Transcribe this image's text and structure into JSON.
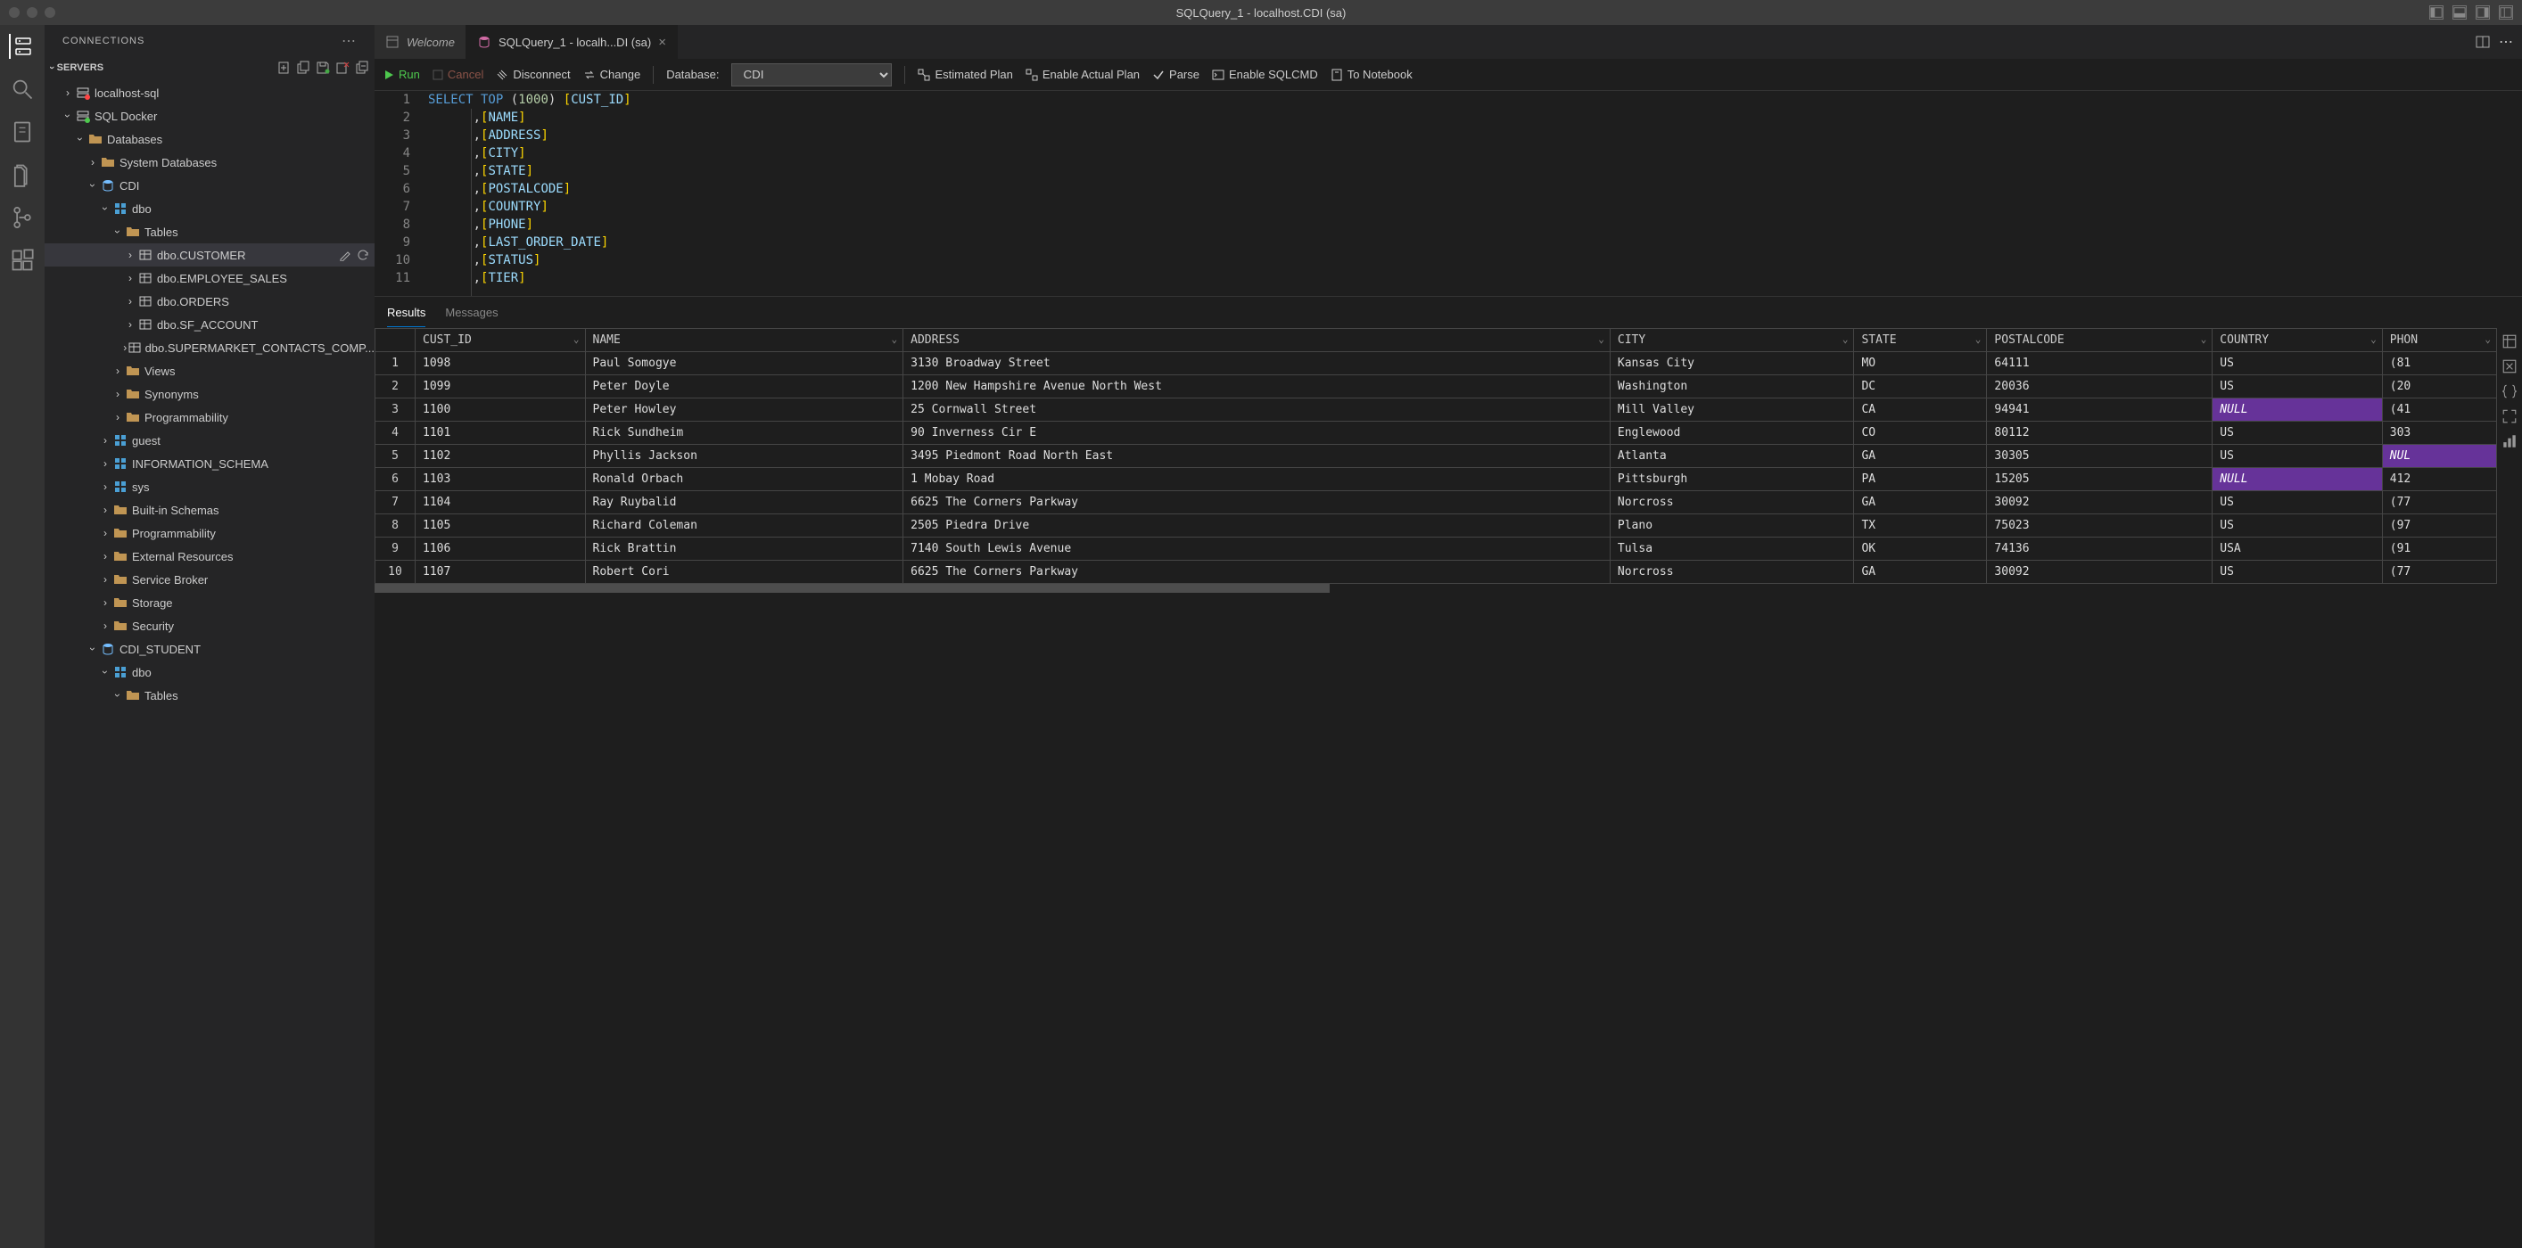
{
  "window": {
    "title": "SQLQuery_1 - localhost.CDI (sa)"
  },
  "sidebar": {
    "title": "CONNECTIONS",
    "servers_label": "SERVERS",
    "tree": [
      {
        "label": "localhost-sql",
        "depth": 1,
        "chev": "closed",
        "icon": "server-red"
      },
      {
        "label": "SQL Docker",
        "depth": 1,
        "chev": "open",
        "icon": "server-green"
      },
      {
        "label": "Databases",
        "depth": 2,
        "chev": "open",
        "icon": "folder"
      },
      {
        "label": "System Databases",
        "depth": 3,
        "chev": "closed",
        "icon": "folder"
      },
      {
        "label": "CDI",
        "depth": 3,
        "chev": "open",
        "icon": "database"
      },
      {
        "label": "dbo",
        "depth": 4,
        "chev": "open",
        "icon": "schema"
      },
      {
        "label": "Tables",
        "depth": 5,
        "chev": "open",
        "icon": "folder"
      },
      {
        "label": "dbo.CUSTOMER",
        "depth": 6,
        "chev": "closed",
        "icon": "table",
        "selected": true,
        "actions": true
      },
      {
        "label": "dbo.EMPLOYEE_SALES",
        "depth": 6,
        "chev": "closed",
        "icon": "table"
      },
      {
        "label": "dbo.ORDERS",
        "depth": 6,
        "chev": "closed",
        "icon": "table"
      },
      {
        "label": "dbo.SF_ACCOUNT",
        "depth": 6,
        "chev": "closed",
        "icon": "table"
      },
      {
        "label": "dbo.SUPERMARKET_CONTACTS_COMP...",
        "depth": 6,
        "chev": "closed",
        "icon": "table"
      },
      {
        "label": "Views",
        "depth": 5,
        "chev": "closed",
        "icon": "folder"
      },
      {
        "label": "Synonyms",
        "depth": 5,
        "chev": "closed",
        "icon": "folder"
      },
      {
        "label": "Programmability",
        "depth": 5,
        "chev": "closed",
        "icon": "folder"
      },
      {
        "label": "guest",
        "depth": 4,
        "chev": "closed",
        "icon": "schema"
      },
      {
        "label": "INFORMATION_SCHEMA",
        "depth": 4,
        "chev": "closed",
        "icon": "schema"
      },
      {
        "label": "sys",
        "depth": 4,
        "chev": "closed",
        "icon": "schema"
      },
      {
        "label": "Built-in Schemas",
        "depth": 4,
        "chev": "closed",
        "icon": "folder"
      },
      {
        "label": "Programmability",
        "depth": 4,
        "chev": "closed",
        "icon": "folder"
      },
      {
        "label": "External Resources",
        "depth": 4,
        "chev": "closed",
        "icon": "folder"
      },
      {
        "label": "Service Broker",
        "depth": 4,
        "chev": "closed",
        "icon": "folder"
      },
      {
        "label": "Storage",
        "depth": 4,
        "chev": "closed",
        "icon": "folder"
      },
      {
        "label": "Security",
        "depth": 4,
        "chev": "closed",
        "icon": "folder"
      },
      {
        "label": "CDI_STUDENT",
        "depth": 3,
        "chev": "open",
        "icon": "database"
      },
      {
        "label": "dbo",
        "depth": 4,
        "chev": "open",
        "icon": "schema"
      },
      {
        "label": "Tables",
        "depth": 5,
        "chev": "open",
        "icon": "folder"
      }
    ]
  },
  "tabs": [
    {
      "label": "Welcome",
      "icon": "home",
      "active": false
    },
    {
      "label": "SQLQuery_1 - localh...DI (sa)",
      "icon": "sql",
      "active": true,
      "close": true
    }
  ],
  "toolbar": {
    "run": "Run",
    "cancel": "Cancel",
    "disconnect": "Disconnect",
    "change": "Change",
    "database_label": "Database:",
    "database_value": "CDI",
    "estimated": "Estimated Plan",
    "actual": "Enable Actual Plan",
    "parse": "Parse",
    "sqlcmd": "Enable SQLCMD",
    "notebook": "To Notebook"
  },
  "code": {
    "lines": [
      {
        "n": 1,
        "tokens": [
          [
            "kw",
            "SELECT"
          ],
          [
            "",
            ""
          ],
          [
            "kw",
            " TOP "
          ],
          [
            "punct",
            "("
          ],
          [
            "num",
            "1000"
          ],
          [
            "punct",
            ")"
          ],
          [
            "",
            ""
          ],
          [
            "brkt",
            " ["
          ],
          [
            "col",
            "CUST_ID"
          ],
          [
            "brkt",
            "]"
          ]
        ]
      },
      {
        "n": 2,
        "tokens": [
          [
            "punct",
            "      ,"
          ],
          [
            "brkt",
            "["
          ],
          [
            "col",
            "NAME"
          ],
          [
            "brkt",
            "]"
          ]
        ]
      },
      {
        "n": 3,
        "tokens": [
          [
            "punct",
            "      ,"
          ],
          [
            "brkt",
            "["
          ],
          [
            "col",
            "ADDRESS"
          ],
          [
            "brkt",
            "]"
          ]
        ]
      },
      {
        "n": 4,
        "tokens": [
          [
            "punct",
            "      ,"
          ],
          [
            "brkt",
            "["
          ],
          [
            "col",
            "CITY"
          ],
          [
            "brkt",
            "]"
          ]
        ]
      },
      {
        "n": 5,
        "tokens": [
          [
            "punct",
            "      ,"
          ],
          [
            "brkt",
            "["
          ],
          [
            "col",
            "STATE"
          ],
          [
            "brkt",
            "]"
          ]
        ]
      },
      {
        "n": 6,
        "tokens": [
          [
            "punct",
            "      ,"
          ],
          [
            "brkt",
            "["
          ],
          [
            "col",
            "POSTALCODE"
          ],
          [
            "brkt",
            "]"
          ]
        ]
      },
      {
        "n": 7,
        "tokens": [
          [
            "punct",
            "      ,"
          ],
          [
            "brkt",
            "["
          ],
          [
            "col",
            "COUNTRY"
          ],
          [
            "brkt",
            "]"
          ]
        ]
      },
      {
        "n": 8,
        "tokens": [
          [
            "punct",
            "      ,"
          ],
          [
            "brkt",
            "["
          ],
          [
            "col",
            "PHONE"
          ],
          [
            "brkt",
            "]"
          ]
        ]
      },
      {
        "n": 9,
        "tokens": [
          [
            "punct",
            "      ,"
          ],
          [
            "brkt",
            "["
          ],
          [
            "col",
            "LAST_ORDER_DATE"
          ],
          [
            "brkt",
            "]"
          ]
        ]
      },
      {
        "n": 10,
        "tokens": [
          [
            "punct",
            "      ,"
          ],
          [
            "brkt",
            "["
          ],
          [
            "col",
            "STATUS"
          ],
          [
            "brkt",
            "]"
          ]
        ]
      },
      {
        "n": 11,
        "tokens": [
          [
            "punct",
            "      ,"
          ],
          [
            "brkt",
            "["
          ],
          [
            "col",
            "TIER"
          ],
          [
            "brkt",
            "]"
          ]
        ]
      }
    ]
  },
  "results": {
    "tabs": {
      "results": "Results",
      "messages": "Messages"
    },
    "columns": [
      "CUST_ID",
      "NAME",
      "ADDRESS",
      "CITY",
      "STATE",
      "POSTALCODE",
      "COUNTRY",
      "PHON"
    ],
    "rows": [
      [
        "1098",
        "Paul Somogye",
        "3130 Broadway Street",
        "Kansas City",
        "MO",
        "64111",
        "US",
        "(81"
      ],
      [
        "1099",
        "Peter Doyle",
        "1200 New Hampshire Avenue North West",
        "Washington",
        "DC",
        "20036",
        "US",
        "(20"
      ],
      [
        "1100",
        "Peter Howley",
        "25 Cornwall Street",
        "Mill Valley",
        "CA",
        "94941",
        "NULL",
        "(41"
      ],
      [
        "1101",
        "Rick Sundheim",
        "90 Inverness Cir E",
        "Englewood",
        "CO",
        "80112",
        "US",
        "303"
      ],
      [
        "1102",
        "Phyllis Jackson",
        "3495 Piedmont Road North East",
        "Atlanta",
        "GA",
        "30305",
        "US",
        "NUL"
      ],
      [
        "1103",
        "Ronald Orbach",
        "1 Mobay Road",
        "Pittsburgh",
        "PA",
        "15205",
        "NULL",
        "412"
      ],
      [
        "1104",
        "Ray Ruybalid",
        "6625 The Corners Parkway",
        "Norcross",
        "GA",
        "30092",
        "US",
        "(77"
      ],
      [
        "1105",
        "Richard Coleman",
        "2505 Piedra Drive",
        "Plano",
        "TX",
        "75023",
        "US",
        "(97"
      ],
      [
        "1106",
        "Rick Brattin",
        "7140 South Lewis Avenue",
        "Tulsa",
        "OK",
        "74136",
        "USA",
        "(91"
      ],
      [
        "1107",
        "Robert Cori",
        "6625 The Corners Parkway",
        "Norcross",
        "GA",
        "30092",
        "US",
        "(77"
      ]
    ],
    "null_cells": [
      [
        2,
        6
      ],
      [
        4,
        7
      ],
      [
        5,
        6
      ]
    ]
  }
}
